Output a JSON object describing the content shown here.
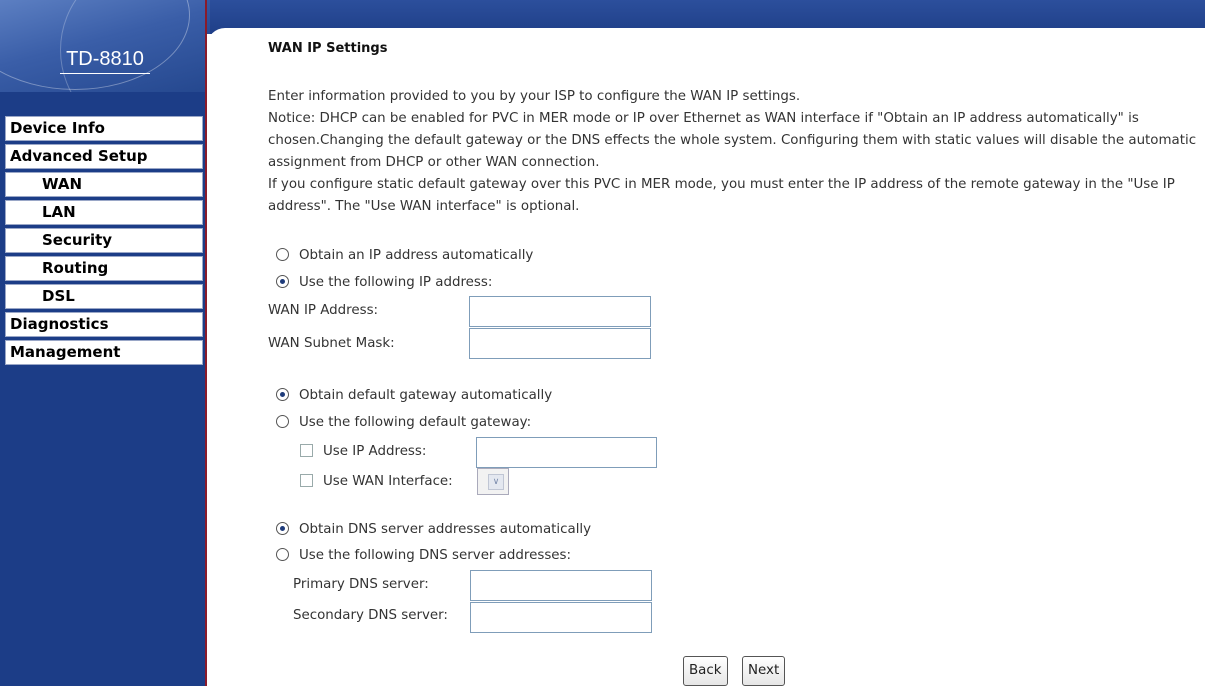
{
  "sidebar": {
    "model": "TD-8810",
    "menu": [
      {
        "label": "Device Info",
        "level": "top"
      },
      {
        "label": "Advanced Setup",
        "level": "top"
      },
      {
        "label": "WAN",
        "level": "sub"
      },
      {
        "label": "LAN",
        "level": "sub"
      },
      {
        "label": "Security",
        "level": "sub"
      },
      {
        "label": "Routing",
        "level": "sub"
      },
      {
        "label": "DSL",
        "level": "sub"
      },
      {
        "label": "Diagnostics",
        "level": "top"
      },
      {
        "label": "Management",
        "level": "top"
      }
    ]
  },
  "main": {
    "title": "WAN IP Settings",
    "intro": [
      "Enter information provided to you by your ISP to configure the WAN IP settings.",
      "Notice: DHCP can be enabled for PVC in MER mode or IP over Ethernet as WAN interface if \"Obtain an IP address automatically\" is chosen.Changing the default gateway or the DNS effects the whole system. Configuring them with static values will disable the automatic assignment from DHCP or other WAN connection.",
      "If you configure static default gateway over this PVC in MER mode, you must enter the IP address of the remote gateway in the \"Use IP address\". The \"Use WAN interface\" is optional."
    ],
    "ip": {
      "auto_label": "Obtain an IP address automatically",
      "manual_label": "Use the following IP address:",
      "selected": "manual",
      "wan_ip_label": "WAN IP Address:",
      "wan_ip_value": "",
      "subnet_label": "WAN Subnet Mask:",
      "subnet_value": ""
    },
    "gateway": {
      "auto_label": "Obtain default gateway automatically",
      "manual_label": "Use the following default gateway:",
      "selected": "auto",
      "use_ip_label": "Use IP Address:",
      "use_ip_checked": false,
      "use_ip_value": "",
      "use_wan_label": "Use WAN Interface:",
      "use_wan_checked": false,
      "use_wan_value": ""
    },
    "dns": {
      "auto_label": "Obtain DNS server addresses automatically",
      "manual_label": "Use the following DNS server addresses:",
      "selected": "auto",
      "primary_label": "Primary DNS server:",
      "primary_value": "",
      "secondary_label": "Secondary DNS server:",
      "secondary_value": ""
    },
    "buttons": {
      "back": "Back",
      "next": "Next"
    }
  },
  "colors": {
    "sidebar_bg": "#1c3d87",
    "banner": "#1f3f88",
    "sidebar_border": "#8a1b2b"
  },
  "icons": {
    "radio": "radio-button",
    "checkbox": "checkbox",
    "dropdown": "chevron-down-icon"
  }
}
